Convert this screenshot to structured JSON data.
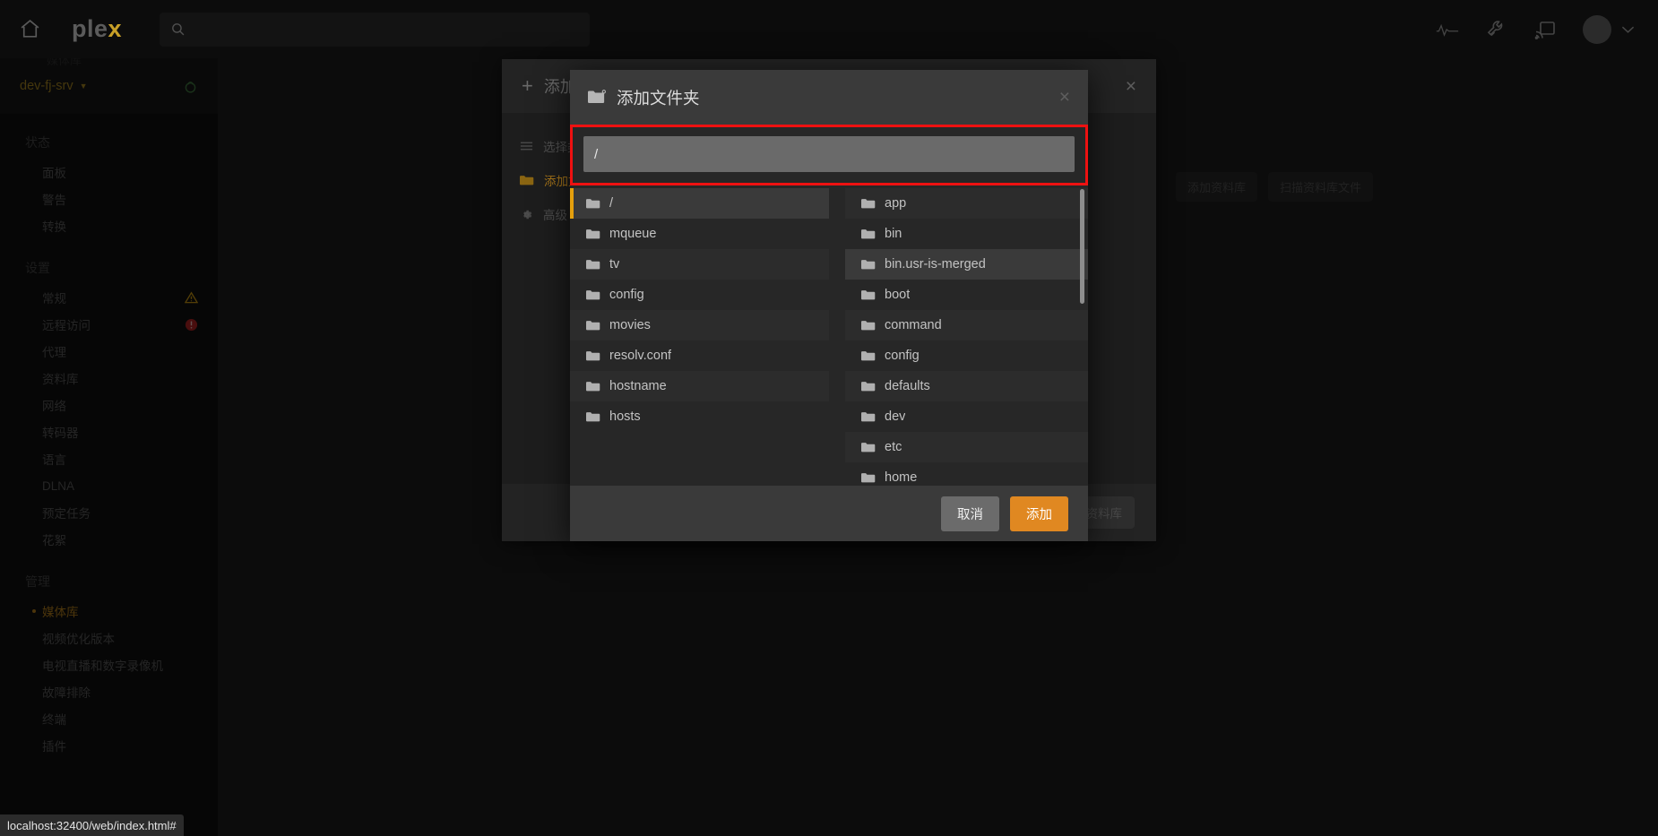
{
  "topbar": {
    "home_icon": "home-icon",
    "logo_text": "ple",
    "logo_accent": "x",
    "search_placeholder": "",
    "search_value": "",
    "icons": [
      "activity-pulse-icon",
      "wrench-icon",
      "cast-icon",
      "avatar",
      "chevron-down-icon"
    ]
  },
  "sidebar": {
    "faint_top_text": "媒体库",
    "server": {
      "name": "dev-fj-srv",
      "caret": "▼",
      "status_icon": "server-status-icon"
    },
    "groups": [
      {
        "label": "状态",
        "items": [
          {
            "label": "面板"
          },
          {
            "label": "警告"
          },
          {
            "label": "转换"
          }
        ]
      },
      {
        "label": "设置",
        "items": [
          {
            "label": "常规",
            "badge": "warning"
          },
          {
            "label": "远程访问",
            "badge": "error"
          },
          {
            "label": "代理"
          },
          {
            "label": "资料库"
          },
          {
            "label": "网络"
          },
          {
            "label": "转码器"
          },
          {
            "label": "语言"
          },
          {
            "label": "DLNA"
          },
          {
            "label": "预定任务"
          },
          {
            "label": "花絮"
          }
        ]
      },
      {
        "label": "管理",
        "items": [
          {
            "label": "媒体库",
            "active": true
          },
          {
            "label": "视频优化版本"
          },
          {
            "label": "电视直播和数字录像机"
          },
          {
            "label": "故障排除"
          },
          {
            "label": "终端"
          },
          {
            "label": "插件"
          }
        ]
      }
    ]
  },
  "page": {
    "actions": [
      {
        "label": "添加资料库"
      },
      {
        "label": "扫描资料库文件"
      }
    ]
  },
  "bg_modal": {
    "title": "添加",
    "plus": "+",
    "close_label": "×",
    "side_items": [
      {
        "label": "选择类",
        "icon": "list-icon"
      },
      {
        "label": "添加文",
        "icon": "folder-icon",
        "selected": true
      },
      {
        "label": "高级",
        "icon": "gear-icon"
      }
    ],
    "footer_button": "资料库"
  },
  "folder_dialog": {
    "title": "添加文件夹",
    "title_icon": "folder-add-icon",
    "close_label": "×",
    "path_value": "/",
    "path_placeholder": "",
    "left_column": [
      {
        "name": "/",
        "selected": true
      },
      {
        "name": "mqueue"
      },
      {
        "name": "tv"
      },
      {
        "name": "config"
      },
      {
        "name": "movies"
      },
      {
        "name": "resolv.conf"
      },
      {
        "name": "hostname"
      },
      {
        "name": "hosts"
      }
    ],
    "right_column": [
      {
        "name": "app"
      },
      {
        "name": "bin"
      },
      {
        "name": "bin.usr-is-merged",
        "hover": true
      },
      {
        "name": "boot"
      },
      {
        "name": "command"
      },
      {
        "name": "config"
      },
      {
        "name": "defaults"
      },
      {
        "name": "dev"
      },
      {
        "name": "etc"
      },
      {
        "name": "home"
      }
    ],
    "cancel_label": "取消",
    "add_label": "添加"
  },
  "statusbar": {
    "url": "localhost:32400/web/index.html#"
  },
  "colors": {
    "accent_orange": "#e5a00d",
    "add_button": "#e08821",
    "highlight_border": "#ee1111",
    "warning": "#b98a11",
    "error": "#a32121"
  }
}
